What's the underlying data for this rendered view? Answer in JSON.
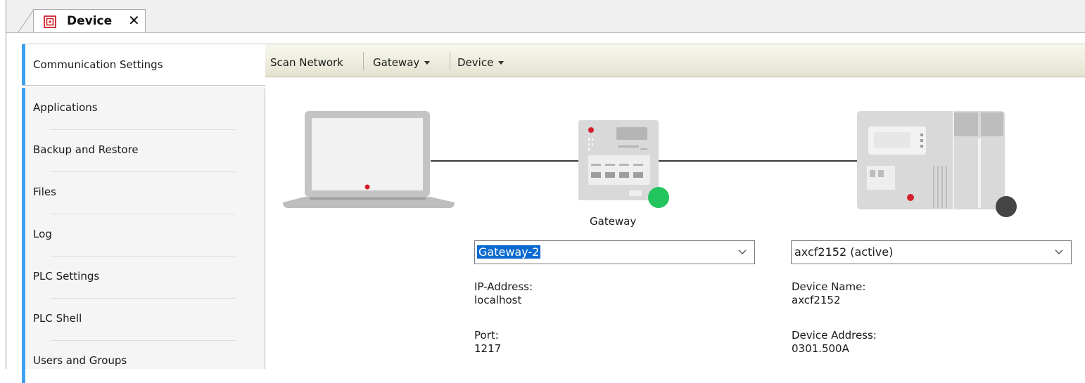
{
  "tab": {
    "title": "Device",
    "close": "✕",
    "icon": "device-icon"
  },
  "nav": {
    "items": [
      {
        "label": "Communication Settings",
        "active": true
      },
      {
        "label": "Applications"
      },
      {
        "label": "Backup and Restore"
      },
      {
        "label": "Files"
      },
      {
        "label": "Log"
      },
      {
        "label": "PLC Settings"
      },
      {
        "label": "PLC Shell"
      },
      {
        "label": "Users and Groups"
      }
    ]
  },
  "toolbar": {
    "scan": "Scan Network",
    "gateway": "Gateway",
    "device": "Device"
  },
  "diagram": {
    "gateway_caption": "Gateway",
    "gateway_status_color": "#22c55e",
    "device_status_color": "#444444"
  },
  "gateway": {
    "selected": "Gateway-2",
    "ip_label": "IP-Address:",
    "ip_value": "localhost",
    "port_label": "Port:",
    "port_value": "1217"
  },
  "device": {
    "selected": "axcf2152 (active)",
    "name_label": "Device Name:",
    "name_value": "axcf2152",
    "addr_label": "Device Address:",
    "addr_value": "0301.500A"
  },
  "colors": {
    "accent": "#3da1f2",
    "brand_red": "#d4202a",
    "selection": "#0a6ad0"
  }
}
